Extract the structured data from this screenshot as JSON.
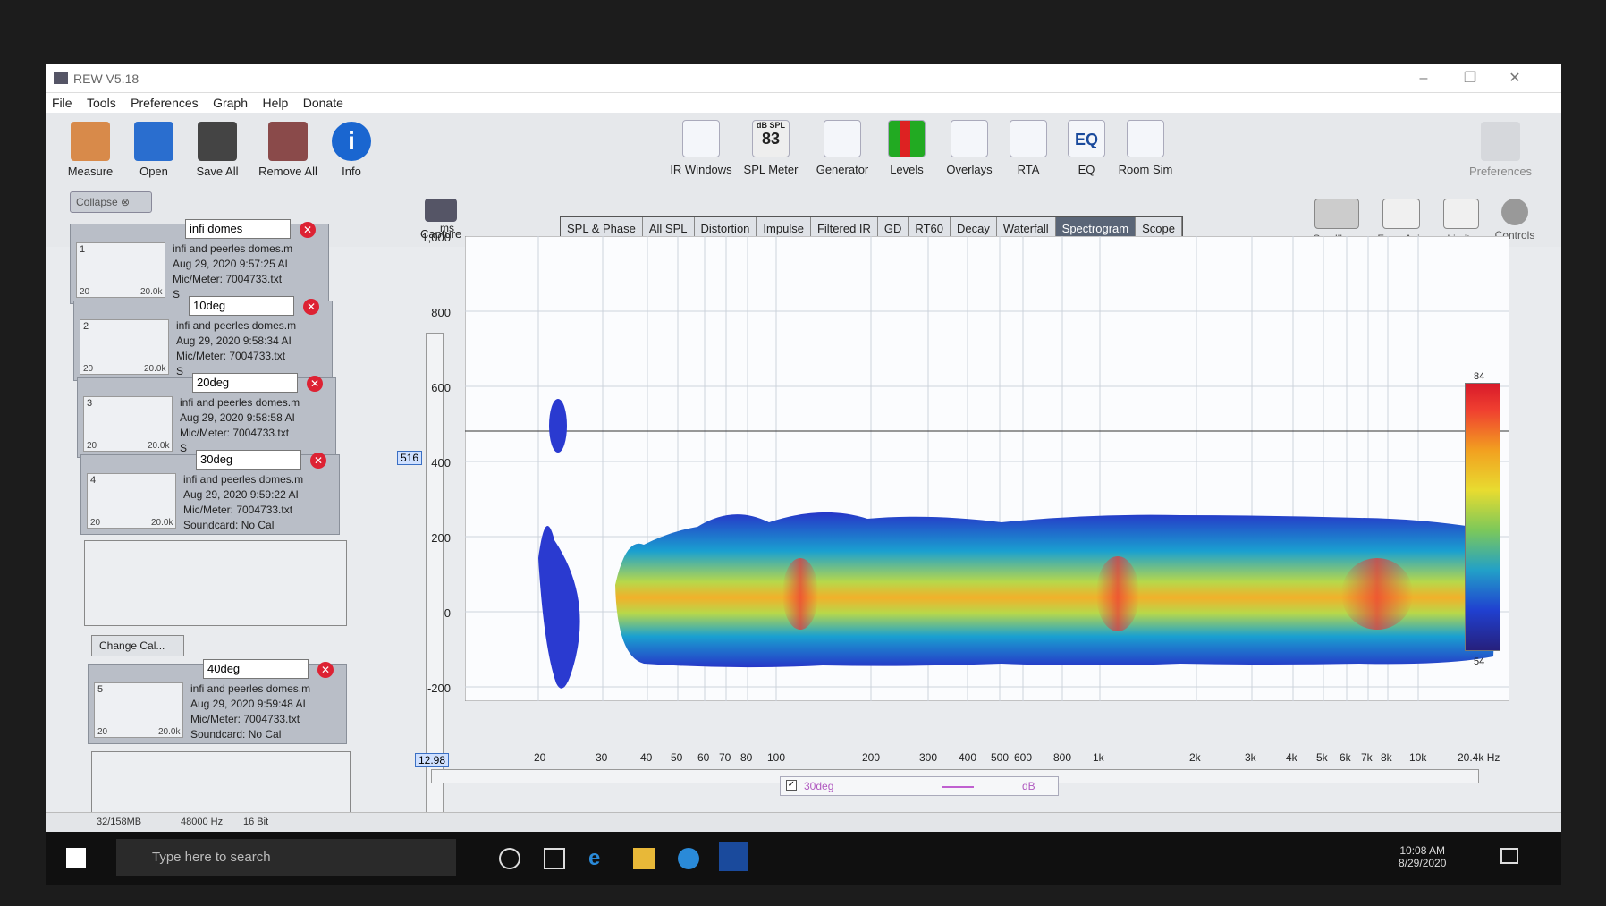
{
  "window": {
    "title": "REW V5.18"
  },
  "menu": [
    "File",
    "Tools",
    "Preferences",
    "Graph",
    "Help",
    "Donate"
  ],
  "toolbar_left": [
    "Measure",
    "Open",
    "Save All",
    "Remove All",
    "Info"
  ],
  "toolbar_graph": [
    "IR Windows",
    "SPL Meter",
    "Generator",
    "Levels",
    "Overlays",
    "RTA",
    "EQ",
    "Room Sim"
  ],
  "spl_meter": {
    "unit": "dB SPL",
    "value": "83"
  },
  "toolbar_right": [
    "Preferences"
  ],
  "view_controls": [
    "Scrollbars",
    "Freq. Axis",
    "Limits",
    "Controls"
  ],
  "capture_label": "Capture",
  "tabs": [
    "SPL & Phase",
    "All SPL",
    "Distortion",
    "Impulse",
    "Filtered IR",
    "GD",
    "RT60",
    "Decay",
    "Waterfall",
    "Spectrogram",
    "Scope"
  ],
  "active_tab": "Spectrogram",
  "collapse_label": "Collapse",
  "measurements": [
    {
      "index": "1",
      "name": "infi domes",
      "file": "infi and peerles domes.m",
      "date": "Aug 29, 2020 9:57:25 AI",
      "meter": "Mic/Meter: 7004733.txt",
      "soundcard": "S",
      "thumb_min": "20",
      "thumb_max": "20.0k"
    },
    {
      "index": "2",
      "name": "10deg",
      "file": "infi and peerles domes.m",
      "date": "Aug 29, 2020 9:58:34 AI",
      "meter": "Mic/Meter: 7004733.txt",
      "soundcard": "S",
      "thumb_min": "20",
      "thumb_max": "20.0k"
    },
    {
      "index": "3",
      "name": "20deg",
      "file": "infi and peerles domes.m",
      "date": "Aug 29, 2020 9:58:58 AI",
      "meter": "Mic/Meter: 7004733.txt",
      "soundcard": "S",
      "thumb_min": "20",
      "thumb_max": "20.0k"
    },
    {
      "index": "4",
      "name": "30deg",
      "file": "infi and peerles domes.m",
      "date": "Aug 29, 2020 9:59:22 AI",
      "meter": "Mic/Meter: 7004733.txt",
      "soundcard": "Soundcard: No Cal",
      "thumb_min": "20",
      "thumb_max": "20.0k"
    },
    {
      "index": "5",
      "name": "40deg",
      "file": "infi and peerles domes.m",
      "date": "Aug 29, 2020 9:59:48 AI",
      "meter": "Mic/Meter: 7004733.txt",
      "soundcard": "Soundcard: No Cal",
      "thumb_min": "20",
      "thumb_max": "20.0k"
    }
  ],
  "change_cal_label": "Change Cal...",
  "plot": {
    "y_unit": "ms",
    "y_ticks": [
      "1,000",
      "800",
      "600",
      "400",
      "200",
      "0",
      "-200"
    ],
    "x_ticks": [
      "20",
      "30",
      "40",
      "50",
      "60",
      "70",
      "80",
      "100",
      "200",
      "300",
      "400",
      "500",
      "600",
      "800",
      "1k",
      "2k",
      "3k",
      "4k",
      "5k",
      "6k",
      "7k",
      "8k",
      "10k"
    ],
    "x_end_label": "20.4k Hz",
    "x_min_label": "12.98",
    "cursor_y_label": "516",
    "colorbar_max": "84",
    "colorbar_min": "54",
    "legend_name": "30deg",
    "legend_unit": "dB"
  },
  "status": {
    "memory": "32/158MB",
    "rate": "48000 Hz",
    "bits": "16 Bit"
  },
  "taskbar": {
    "search_placeholder": "Type here to search",
    "time": "10:08 AM",
    "date": "8/29/2020"
  }
}
